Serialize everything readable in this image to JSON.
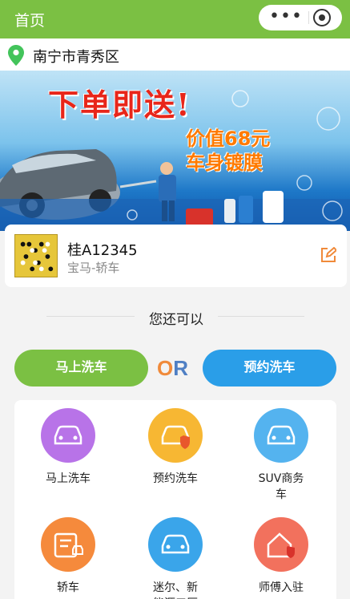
{
  "nav": {
    "title": "首页",
    "more_icon": "more-dots-icon",
    "close_icon": "target-icon"
  },
  "location": {
    "city": "南宁市青秀区",
    "icon": "location-pin-icon",
    "pin_color": "#43c45b"
  },
  "banner": {
    "headline": "下单即送!",
    "line2": "价值68元",
    "line3": "车身镀膜"
  },
  "car": {
    "plate": "桂A12345",
    "model": "宝马-轿车",
    "edit_icon": "edit-icon"
  },
  "divider_text": "您还可以",
  "actions": {
    "wash_now": "马上洗车",
    "or_o": "O",
    "or_r": "R",
    "book_wash": "预约洗车"
  },
  "services": [
    {
      "label": "马上洗车",
      "icon": "car-icon",
      "color": "#b873e8"
    },
    {
      "label": "预约洗车",
      "icon": "car-shield-icon",
      "color": "#f7b733"
    },
    {
      "label": "SUV商务车",
      "icon": "suv-icon",
      "color": "#54b3ef"
    },
    {
      "label": "轿车",
      "icon": "sedan-document-icon",
      "color": "#f58a3c"
    },
    {
      "label": "迷尔、新能源三厢",
      "icon": "compact-car-icon",
      "color": "#3aa5ea"
    },
    {
      "label": "师傅入驻",
      "icon": "house-shield-icon",
      "color": "#f2715d"
    }
  ],
  "colors": {
    "brand_green": "#7bc043",
    "brand_blue": "#2a9ee8"
  }
}
